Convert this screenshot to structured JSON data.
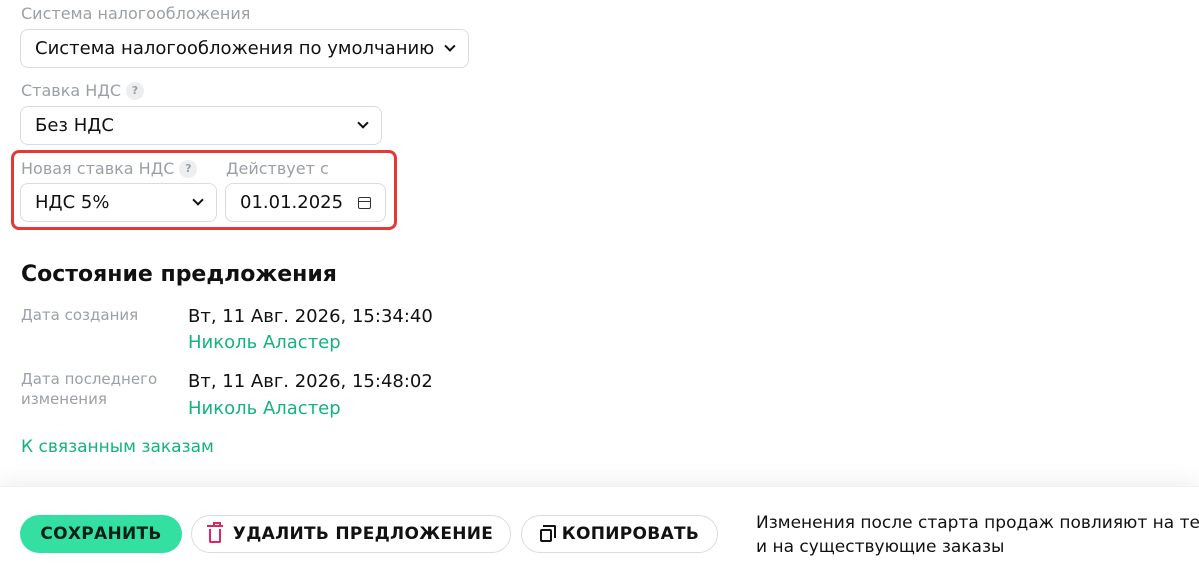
{
  "tax_system": {
    "label": "Система налогообложения",
    "value": "Система налогообложения по умолчанию"
  },
  "vat_rate": {
    "label": "Ставка НДС",
    "help": "?",
    "value": "Без НДС"
  },
  "new_vat_rate": {
    "label": "Новая ставка НДС",
    "help": "?",
    "value": "НДС 5%"
  },
  "effective_from": {
    "label": "Действует с",
    "value": "01.01.2025"
  },
  "offer_state": {
    "title": "Состояние предложения",
    "created": {
      "label": "Дата создания",
      "datetime": "Вт, 11 Авг. 2026, 15:34:40",
      "author": "Николь Аластер"
    },
    "modified": {
      "label": "Дата последнего изменения",
      "datetime": "Вт, 11 Авг. 2026, 15:48:02",
      "author": "Николь Аластер"
    },
    "orders_link": "К связанным заказам"
  },
  "footer": {
    "save_label": "СОХРАНИТЬ",
    "delete_label": "УДАЛИТЬ ПРЕДЛОЖЕНИЕ",
    "copy_label": "КОПИРОВАТЬ",
    "note_line1": "Изменения после старта продаж повлияют на те",
    "note_line2": "и на существующие заказы"
  },
  "colors": {
    "accent": "#34e0a1",
    "link": "#13b37f",
    "highlight": "#e53935",
    "danger": "#e0245e"
  }
}
